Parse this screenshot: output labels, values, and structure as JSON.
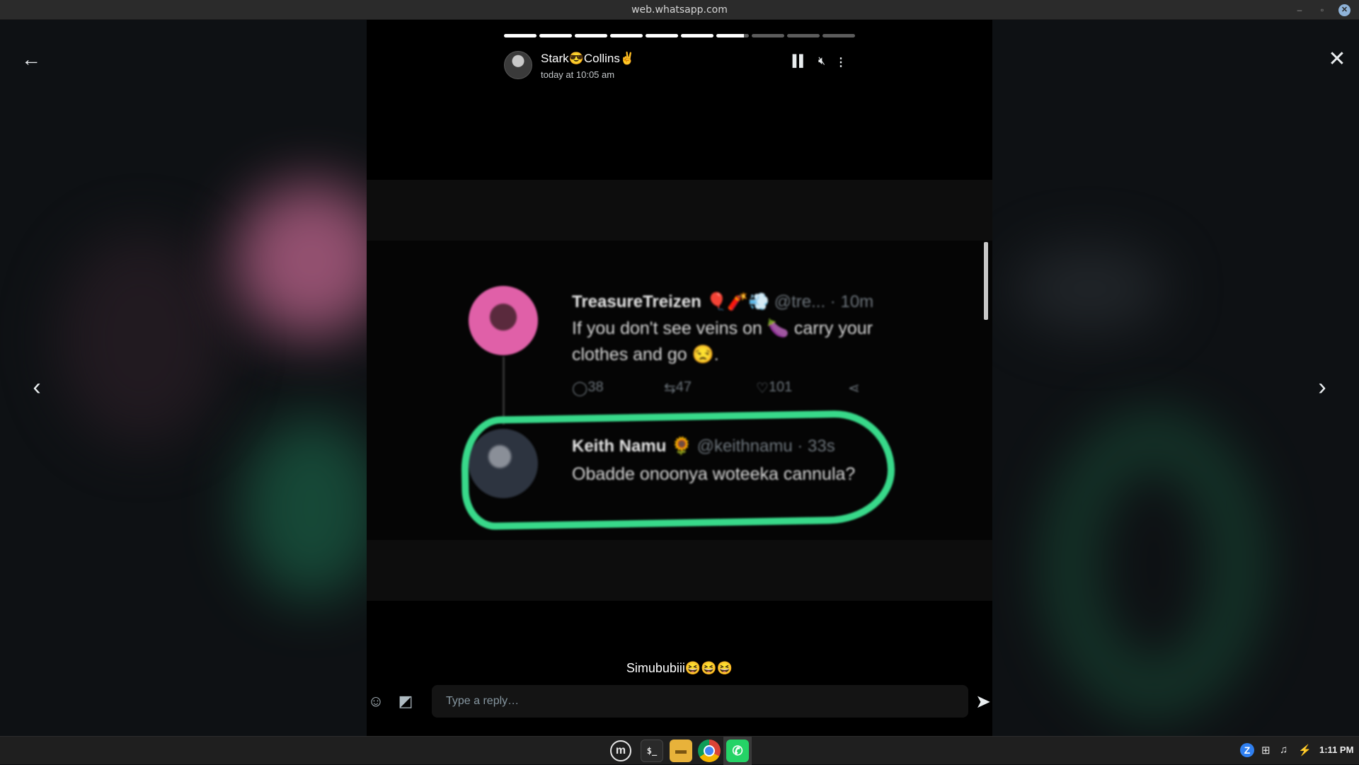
{
  "window": {
    "title": "web.whatsapp.com",
    "minimize_glyph": "–",
    "maximize_glyph": "▫",
    "close_glyph": "✕"
  },
  "viewer": {
    "back_icon": "arrow-left-icon",
    "close_icon": "close-icon",
    "prev_icon": "chevron-left-icon",
    "next_icon": "chevron-right-icon"
  },
  "story": {
    "progress": {
      "total": 10,
      "completed": 6,
      "current_fraction": 0.85
    },
    "contact_name": "Stark😎Collins✌",
    "timestamp": "today at 10:05 am",
    "controls": {
      "pause_icon": "pause-icon",
      "mute_icon": "mute-icon",
      "more_icon": "more-vertical-icon"
    },
    "media": {
      "tweet1": {
        "name": "TreasureTreizen",
        "name_emojis": "🎈🧨💨",
        "handle": "@tre... · 10m",
        "text_line1": "If you don't see veins on 🍆 carry your",
        "text_line2": "clothes and go 😒.",
        "replies": "38",
        "retweets": "47",
        "likes": "101"
      },
      "tweet2": {
        "name": "Keith Namu",
        "name_emoji": "🌻",
        "handle": "@keithnamu · 33s",
        "text": "Obadde onoonya woteeka cannula?"
      },
      "highlight_color": "#38d98a"
    },
    "caption": "Simububiii😆😆😆"
  },
  "reply": {
    "placeholder": "Type a reply…",
    "value": "",
    "emoji_icon": "emoji-icon",
    "sticker_icon": "sticker-icon",
    "send_icon": "send-icon"
  },
  "taskbar": {
    "apps": [
      "mint-menu-icon",
      "terminal-icon",
      "files-icon",
      "chrome-icon",
      "whatsapp-icon"
    ],
    "active_app": "whatsapp",
    "tray": {
      "z_label": "Z",
      "clock": "1:11 PM"
    }
  },
  "colors": {
    "accent_green": "#25d366",
    "story_bg": "#000000",
    "titlebar_bg": "#2b2b2b"
  }
}
